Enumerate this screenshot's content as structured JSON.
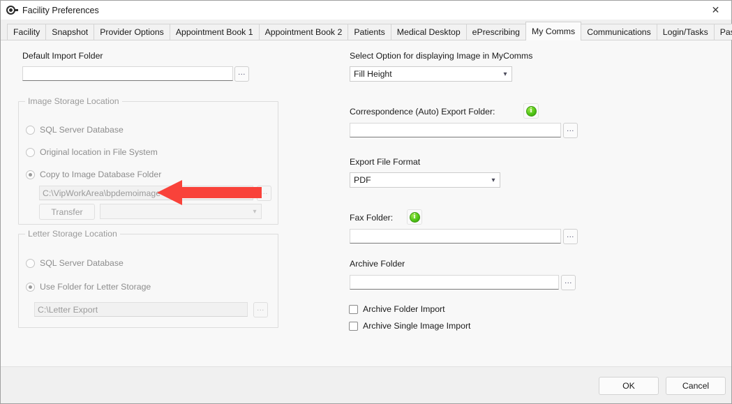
{
  "window": {
    "title": "Facility Preferences",
    "icon": "target-pointer-icon",
    "close_label": "✕"
  },
  "tabs": [
    {
      "label": "Facility",
      "active": false
    },
    {
      "label": "Snapshot",
      "active": false
    },
    {
      "label": "Provider Options",
      "active": false
    },
    {
      "label": "Appointment Book 1",
      "active": false
    },
    {
      "label": "Appointment Book 2",
      "active": false
    },
    {
      "label": "Patients",
      "active": false
    },
    {
      "label": "Medical Desktop",
      "active": false
    },
    {
      "label": "ePrescribing",
      "active": false
    },
    {
      "label": "My Comms",
      "active": true
    },
    {
      "label": "Communications",
      "active": false
    },
    {
      "label": "Login/Tasks",
      "active": false
    },
    {
      "label": "Password Policy",
      "active": false
    }
  ],
  "left": {
    "default_import_folder": {
      "label": "Default Import Folder",
      "value": "",
      "browse_label": "..."
    },
    "image_storage": {
      "title": "Image Storage Location",
      "options": [
        {
          "label": "SQL Server Database",
          "selected": false
        },
        {
          "label": "Original location in File System",
          "selected": false
        },
        {
          "label": "Copy to Image Database Folder",
          "selected": true
        }
      ],
      "path_value": "C:\\VipWorkArea\\bpdemoimage",
      "path_browse_label": "...",
      "transfer_label": "Transfer",
      "transfer_target_value": ""
    },
    "letter_storage": {
      "title": "Letter Storage Location",
      "options": [
        {
          "label": "SQL Server Database",
          "selected": false
        },
        {
          "label": "Use Folder for Letter Storage",
          "selected": true
        }
      ],
      "path_value": "C:\\Letter Export",
      "path_browse_label": "..."
    }
  },
  "right": {
    "display_option": {
      "label": "Select Option for displaying Image in MyComms",
      "value": "Fill Height"
    },
    "correspondence_export": {
      "label": "Correspondence (Auto) Export Folder:",
      "info_icon": "info-icon",
      "value": "",
      "browse_label": "..."
    },
    "export_file_format": {
      "label": "Export File Format",
      "value": "PDF"
    },
    "fax_folder": {
      "label": "Fax Folder:",
      "info_icon": "info-icon",
      "value": "",
      "browse_label": "..."
    },
    "archive_folder": {
      "label": "Archive Folder",
      "value": "",
      "browse_label": "..."
    },
    "checkboxes": [
      {
        "label": "Archive Folder Import",
        "checked": false
      },
      {
        "label": "Archive Single Image Import",
        "checked": false
      }
    ]
  },
  "footer": {
    "ok_label": "OK",
    "cancel_label": "Cancel"
  },
  "annotation": {
    "type": "arrow",
    "direction": "left",
    "color": "#f9423a",
    "points_at": "image-database-folder-path-input"
  }
}
